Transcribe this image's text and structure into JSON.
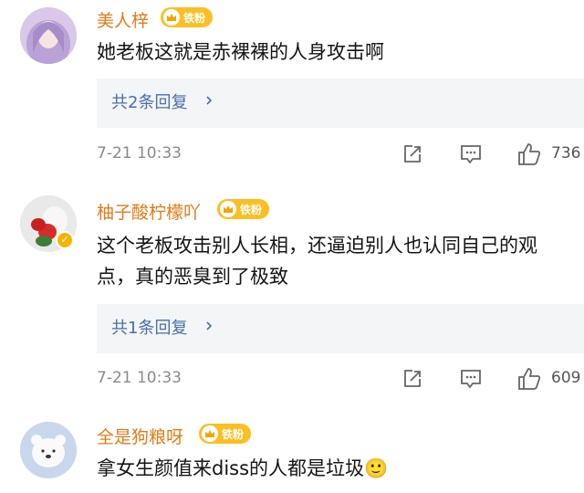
{
  "comments": [
    {
      "username": "美人梓",
      "badge": "铁粉",
      "text": "她老板这就是赤裸裸的人身攻击啊",
      "replies": "共2条回复",
      "timestamp": "7-21 10:33",
      "likes": "736",
      "verified": false
    },
    {
      "username": "柚子酸柠檬吖",
      "badge": "铁粉",
      "text": "这个老板攻击别人长相，还逼迫别人也认同自己的观点，真的恶臭到了极致",
      "replies": "共1条回复",
      "timestamp": "7-21 10:33",
      "likes": "609",
      "verified": true
    },
    {
      "username": "全是狗粮呀",
      "badge": "铁粉",
      "text": "拿女生颜值来diss的人都是垃圾🙂",
      "verified": false
    }
  ],
  "icons": {
    "share": "share-icon",
    "comment": "comment-icon",
    "like": "thumbs-up-icon",
    "badge": "crown-icon",
    "reply_arrow": "chevron-right-icon"
  },
  "colors": {
    "username": "#e07b18",
    "badge": "#fbbf24",
    "reply_link": "#4b6fa8",
    "reply_bg": "#f3f5f7",
    "meta": "#8a8a8a"
  }
}
